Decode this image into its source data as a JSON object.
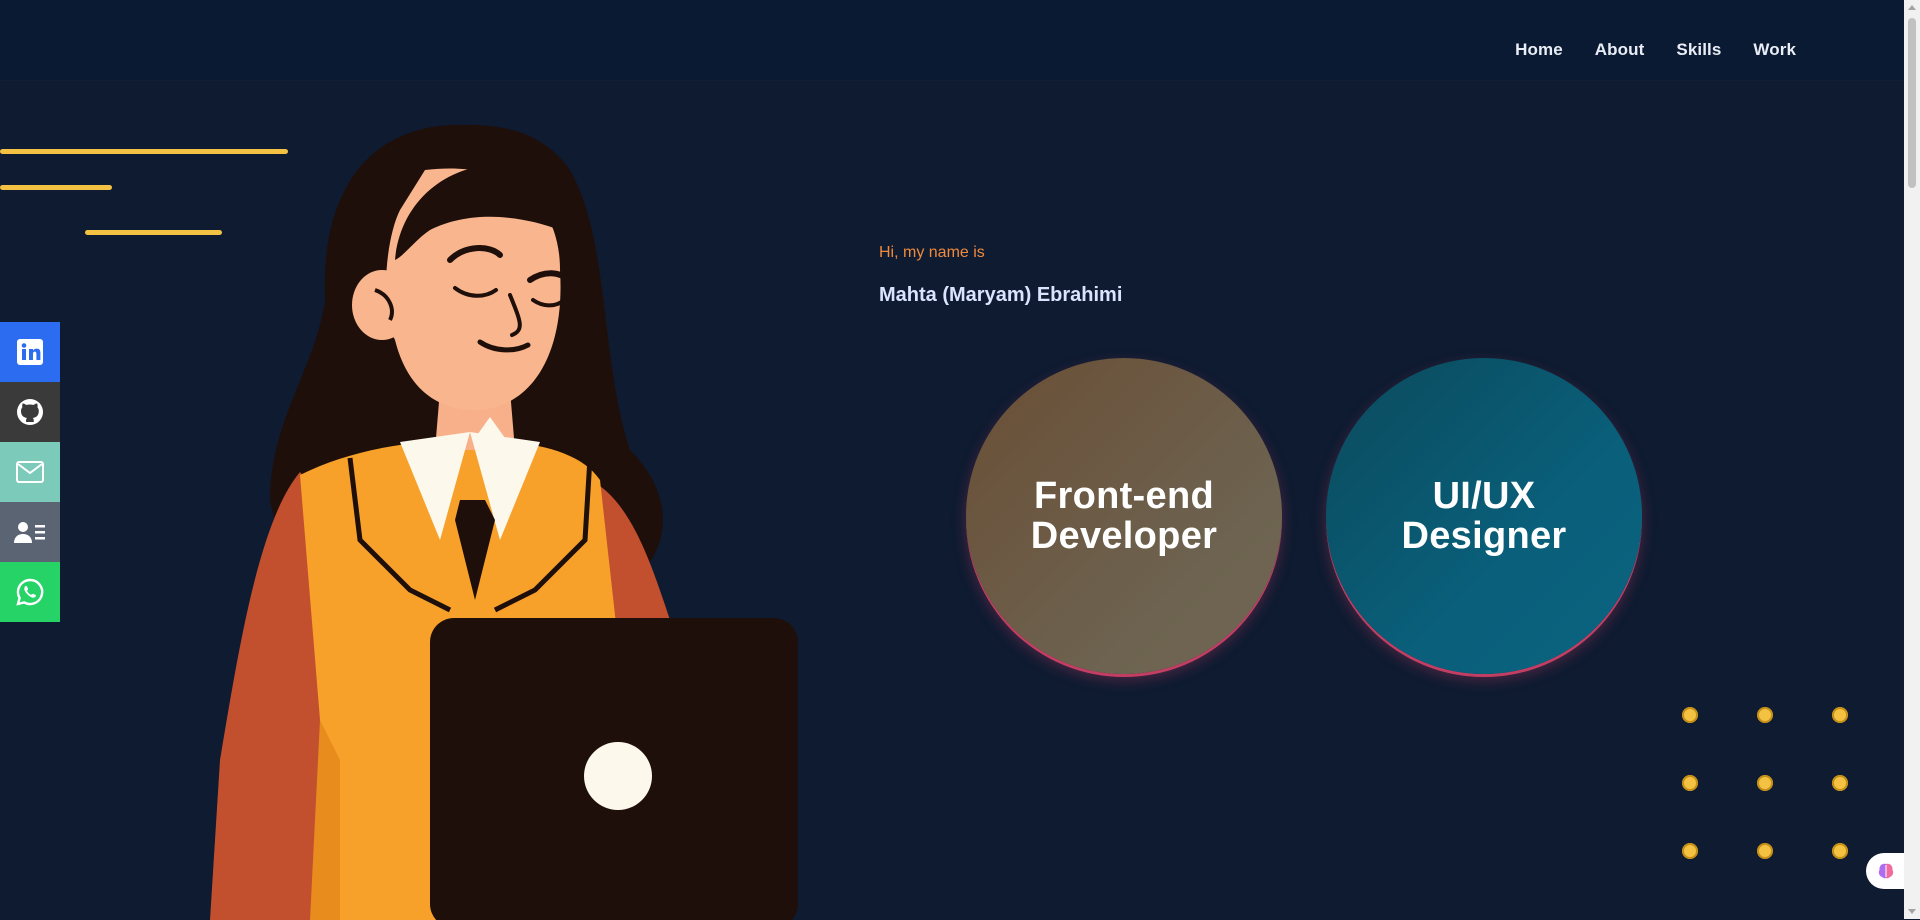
{
  "nav": {
    "links": [
      "Home",
      "About",
      "Skills",
      "Work"
    ]
  },
  "hero": {
    "greeting": "Hi, my name is",
    "name": "Mahta (Maryam) Ebrahimi",
    "roles": [
      {
        "line1": "Front-end",
        "line2": "Developer"
      },
      {
        "line1": "UI/UX",
        "line2": "Designer"
      }
    ]
  },
  "social": [
    {
      "icon": "linkedin-icon",
      "color": "#2c6cf0"
    },
    {
      "icon": "github-icon",
      "color": "#3a3a3a"
    },
    {
      "icon": "mail-icon",
      "color": "#7ccab9"
    },
    {
      "icon": "contact-card-icon",
      "color": "#5a6473"
    },
    {
      "icon": "whatsapp-icon",
      "color": "#25d366"
    }
  ],
  "colors": {
    "background": "#0e1b31",
    "navbar": "#0b1a33",
    "accent_yellow": "#f4c242",
    "greeting_orange": "#f08a3e",
    "circle_ring": "#c43d63"
  }
}
